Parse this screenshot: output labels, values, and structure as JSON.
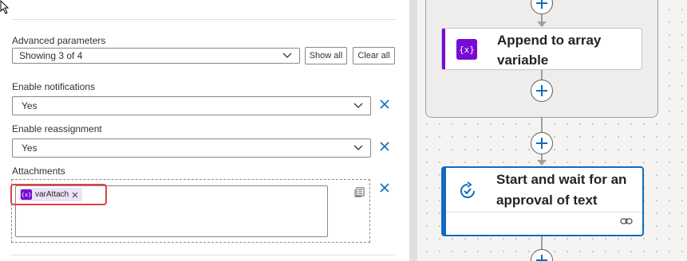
{
  "advanced": {
    "label": "Advanced parameters",
    "value": "Showing 3 of 4",
    "show_all": "Show all",
    "clear_all": "Clear all"
  },
  "notifications": {
    "label": "Enable notifications",
    "value": "Yes"
  },
  "reassignment": {
    "label": "Enable reassignment",
    "value": "Yes"
  },
  "attachments": {
    "label": "Attachments",
    "token": "varAttach"
  },
  "flow": {
    "append_card": {
      "title_line1": "Append to array",
      "title_line2": "variable",
      "accent": "#770bd6"
    },
    "approval_card": {
      "title_line1": "Start and wait for an",
      "title_line2": "approval of text",
      "accent": "#0f6cbd"
    }
  }
}
